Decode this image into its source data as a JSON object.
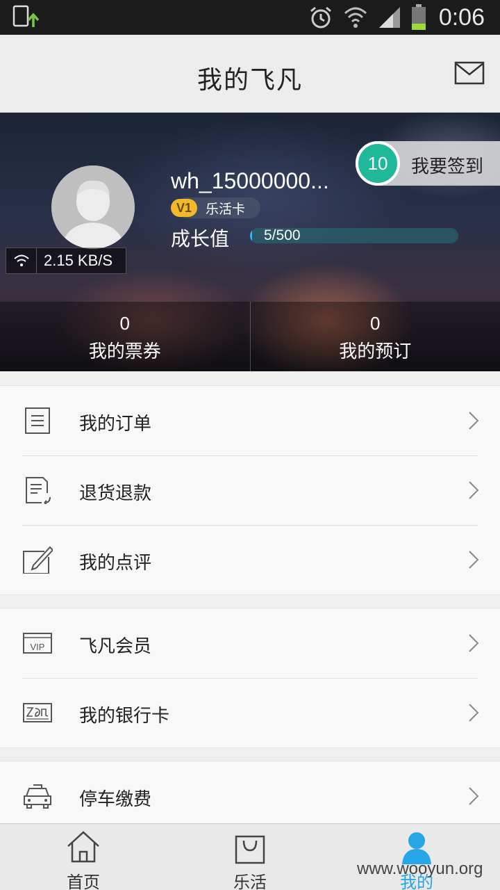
{
  "status_bar": {
    "time": "0:06",
    "icons": [
      "download-icon",
      "alarm-icon",
      "wifi-icon",
      "signal-icon",
      "battery-icon"
    ]
  },
  "header": {
    "title": "我的飞凡",
    "mail_icon": "mail-icon"
  },
  "profile": {
    "username": "wh_15000000...",
    "level_badge": "V1",
    "card_name": "乐活卡",
    "growth_label": "成长值",
    "growth_text": "5/500",
    "growth_progress": 0.01,
    "net_speed": "2.15 KB/S",
    "signin_count": "10",
    "signin_label": "我要签到"
  },
  "stats": [
    {
      "count": "0",
      "label": "我的票券"
    },
    {
      "count": "0",
      "label": "我的预订"
    }
  ],
  "menu_groups": [
    [
      {
        "label": "我的订单",
        "icon": "order-list-icon"
      },
      {
        "label": "退货退款",
        "icon": "refund-icon"
      },
      {
        "label": "我的点评",
        "icon": "review-edit-icon"
      }
    ],
    [
      {
        "label": "飞凡会员",
        "icon": "vip-card-icon"
      },
      {
        "label": "我的银行卡",
        "icon": "bank-card-icon"
      }
    ],
    [
      {
        "label": "停车缴费",
        "icon": "car-icon"
      }
    ]
  ],
  "bottom_nav": [
    {
      "label": "首页",
      "icon": "home-icon",
      "active": false
    },
    {
      "label": "乐活",
      "icon": "shopping-bag-icon",
      "active": false
    },
    {
      "label": "我的",
      "icon": "person-icon",
      "active": true
    }
  ],
  "watermark": "www.wooyun.org",
  "colors": {
    "accent": "#26a6e8",
    "signin_badge": "#1fb99a",
    "level_badge": "#f2b92a",
    "progress": "#3fb2ff"
  }
}
